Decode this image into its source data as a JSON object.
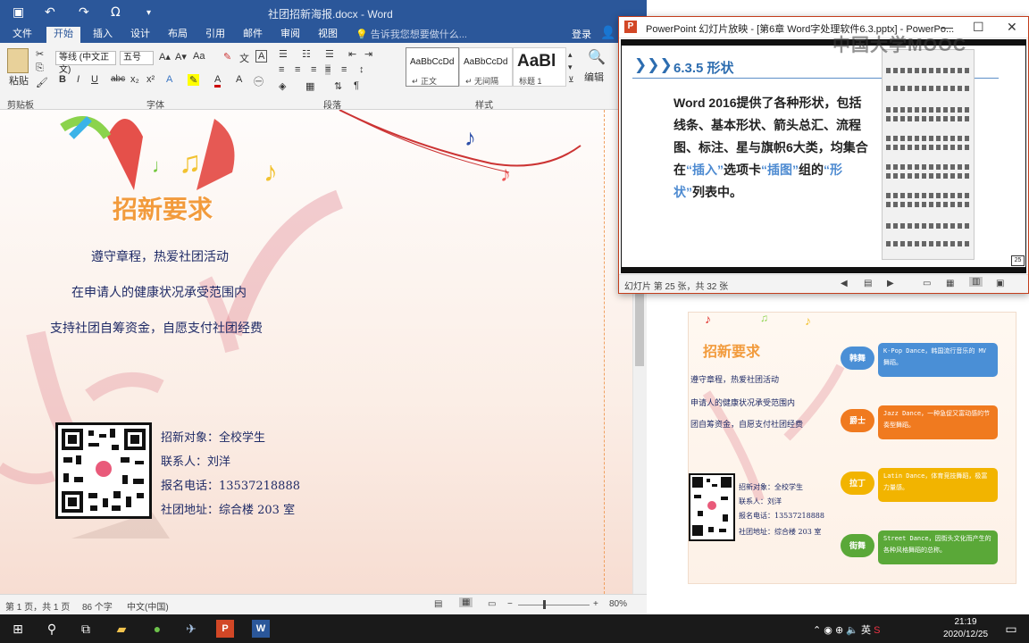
{
  "word": {
    "window_title": "社团招新海报.docx - Word",
    "quick_access": {
      "save_icon": "save-icon",
      "undo_icon": "undo-icon",
      "redo_icon": "redo-icon",
      "symbol_label": "Ω"
    },
    "tabs": [
      "文件",
      "开始",
      "插入",
      "设计",
      "布局",
      "引用",
      "邮件",
      "审阅",
      "视图"
    ],
    "active_tab": "开始",
    "search_placeholder": "告诉我您想要做什么...",
    "login_label": "登录",
    "ribbon": {
      "paste_label": "粘贴",
      "clipboard_group": "剪贴板",
      "font_group": "字体",
      "paragraph_group": "段落",
      "styles_group": "样式",
      "edit_label": "编辑",
      "font_name": "等线 (中文正文)",
      "font_size": "五号",
      "bold": "B",
      "italic": "I",
      "underline": "U",
      "strike": "abc",
      "subscript": "x₂",
      "superscript": "x²",
      "font_color_a": "A",
      "aa_label": "Aa",
      "styles": [
        {
          "preview": "AaBbCcDd",
          "name": "↵ 正文"
        },
        {
          "preview": "AaBbCcDd",
          "name": "↵ 无间隔"
        },
        {
          "preview": "AaBl",
          "name": "标题 1"
        }
      ]
    },
    "document": {
      "heading": "招新要求",
      "lines": [
        "遵守章程，热爱社团活动",
        "在申请人的健康状况承受范围内",
        "支持社团自筹资金，自愿支付社团经费"
      ],
      "info": [
        "招新对象：全校学生",
        "联系人：刘洋",
        "报名电话：13537218888",
        "社团地址：综合楼 203 室"
      ]
    },
    "status": {
      "page": "第 1 页，共 1 页",
      "words": "86 个字",
      "language": "中文(中国)",
      "zoom": "80%",
      "zoom_minus": "−",
      "zoom_plus": "+"
    }
  },
  "ppt": {
    "window_title": "PowerPoint 幻灯片放映 - [第6章 Word字处理软件6.3.pptx] - PowerPo...",
    "slide_heading": "6.3.5  形状",
    "slide_body_pre": "Word 2016提供了各种形状，包括线条、基本形状、箭头总汇、流程图、标注、星与旗帜6大类，均集合在",
    "slide_body_hl1": "“插入”",
    "slide_body_mid": "选项卡",
    "slide_body_hl2": "“插图”",
    "slide_body_mid2": "组的",
    "slide_body_hl3": "“形状”",
    "slide_body_post": "列表中。",
    "slide_number": "25",
    "status_text": "幻灯片 第 25 张，共 32 张"
  },
  "poster": {
    "heading": "招新要求",
    "lines": [
      "遵守章程，热爱社团活动",
      "申请人的健康状况承受范围内",
      "团自筹资金，自愿支付社团经费"
    ],
    "info": [
      "招新对象：全校学生",
      "联系人：刘洋",
      "报名电话：13537218888",
      "社团地址：综合楼 203 室"
    ],
    "dances": [
      {
        "name": "韩舞",
        "desc": "K-Pop Dance，韩国流行音乐的 MV 舞蹈。",
        "color": "#4a8fd6"
      },
      {
        "name": "爵士",
        "desc": "Jazz Dance，一种急促又富动感的节奏型舞蹈。",
        "color": "#f07a1f"
      },
      {
        "name": "拉丁",
        "desc": "Latin Dance，体育竞技舞蹈，极富力量感。",
        "color": "#f2b400"
      },
      {
        "name": "街舞",
        "desc": "Street Dance，因街头文化而产生的各种风格舞蹈的总称。",
        "color": "#5aa838"
      }
    ]
  },
  "watermark": "中国大学MOOC",
  "taskbar": {
    "time": "21:19",
    "date": "2020/12/25",
    "ime": "英",
    "icons": [
      "windows-icon",
      "search-icon",
      "task-view-icon",
      "file-explorer-icon",
      "browser-icon",
      "app-icon",
      "powerpoint-icon",
      "word-icon"
    ]
  }
}
